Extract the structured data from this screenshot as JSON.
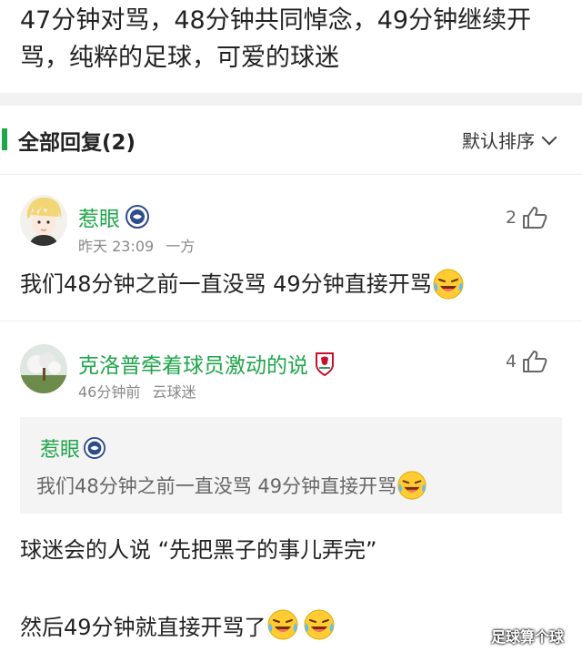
{
  "post": {
    "text_line1": "47分钟对骂，48分钟共同悼念，49分钟继续开",
    "text_line2": "骂，纯粹的足球，可爱的球迷"
  },
  "replies_header": {
    "title": "全部回复(2)",
    "sort_label": "默认排序"
  },
  "comments": [
    {
      "username": "惹眼",
      "time": "昨天 23:09",
      "tag": "一方",
      "likes": "2",
      "text": "我们48分钟之前一直没骂 49分钟直接开骂",
      "emoji": "laughing-crying-emoji"
    },
    {
      "username": "克洛普牵着球员激动的说",
      "time": "46分钟前",
      "tag": "云球迷",
      "likes": "4",
      "quote": {
        "username": "惹眼",
        "text": "我们48分钟之前一直没骂 49分钟直接开骂"
      },
      "line1": "球迷会的人说 “先把黑子的事儿弄完”",
      "line2": "然后49分钟就直接开骂了"
    }
  ],
  "watermark": "足球算个球",
  "colors": {
    "accent_green": "#1fa64a",
    "quote_bg": "#f4f4f4",
    "section_gap": "#f2f2f2"
  }
}
